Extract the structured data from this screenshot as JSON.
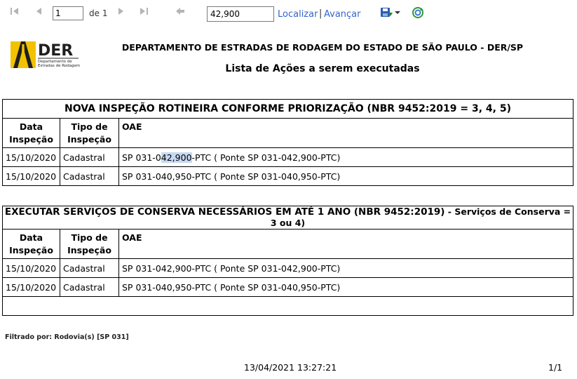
{
  "toolbar": {
    "page_value": "1",
    "of_text": "de 1",
    "find_value": "42,900",
    "find_label": "Localizar",
    "separator": "|",
    "next_label": "Avançar",
    "icons": [
      "first-page-icon",
      "previous-page-icon",
      "next-page-icon",
      "last-page-icon",
      "back-icon",
      "save-export-icon",
      "dropdown-arrow-icon",
      "refresh-icon"
    ],
    "accent": "#3366cc"
  },
  "logo": {
    "text": "DER",
    "subtitle_line1": "Departamento de",
    "subtitle_line2": "Estradas de Rodagem",
    "colors": {
      "yellow": "#f2c200",
      "dark": "#1f1f1f"
    }
  },
  "header": {
    "organization": "DEPARTAMENTO DE ESTRADAS DE RODAGEM DO ESTADO DE SÃO PAULO - DER/SP",
    "title": "Lista de Ações a serem executadas"
  },
  "sections": [
    {
      "title": "NOVA INSPEÇÃO ROTINEIRA CONFORME PRIORIZAÇÃO (NBR 9452:2019 = 3, 4, 5)",
      "columns": {
        "date": "Data\nInspeção",
        "type": "Tipo de\nInspeção",
        "oae": "OAE"
      },
      "rows": [
        {
          "date": "15/10/2020",
          "type": "Cadastral",
          "oae_pre": "SP 031-0",
          "oae_highlight": "42,900",
          "oae_post": "-PTC ( Ponte SP 031-042,900-PTC)"
        },
        {
          "date": "15/10/2020",
          "type": "Cadastral",
          "oae": "SP 031-040,950-PTC ( Ponte SP 031-040,950-PTC)"
        }
      ]
    },
    {
      "title_main": "EXECUTAR SERVIÇOS DE CONSERVA NECESSÁRIOS EM ATÉ 1 ANO (NBR 9452:2019)",
      "title_suffix": " - Serviços de Conserva = 3 ou 4)",
      "columns": {
        "date": "Data\nInspeção",
        "type": "Tipo de\nInspeção",
        "oae": "OAE"
      },
      "rows": [
        {
          "date": "15/10/2020",
          "type": "Cadastral",
          "oae": "SP 031-042,900-PTC ( Ponte SP 031-042,900-PTC)"
        },
        {
          "date": "15/10/2020",
          "type": "Cadastral",
          "oae": "SP 031-040,950-PTC ( Ponte SP 031-040,950-PTC)"
        }
      ]
    }
  ],
  "footer": {
    "filter": "Filtrado por: Rodovia(s) [SP 031]",
    "timestamp": "13/04/2021 13:27:21",
    "page_count": "1/1"
  }
}
